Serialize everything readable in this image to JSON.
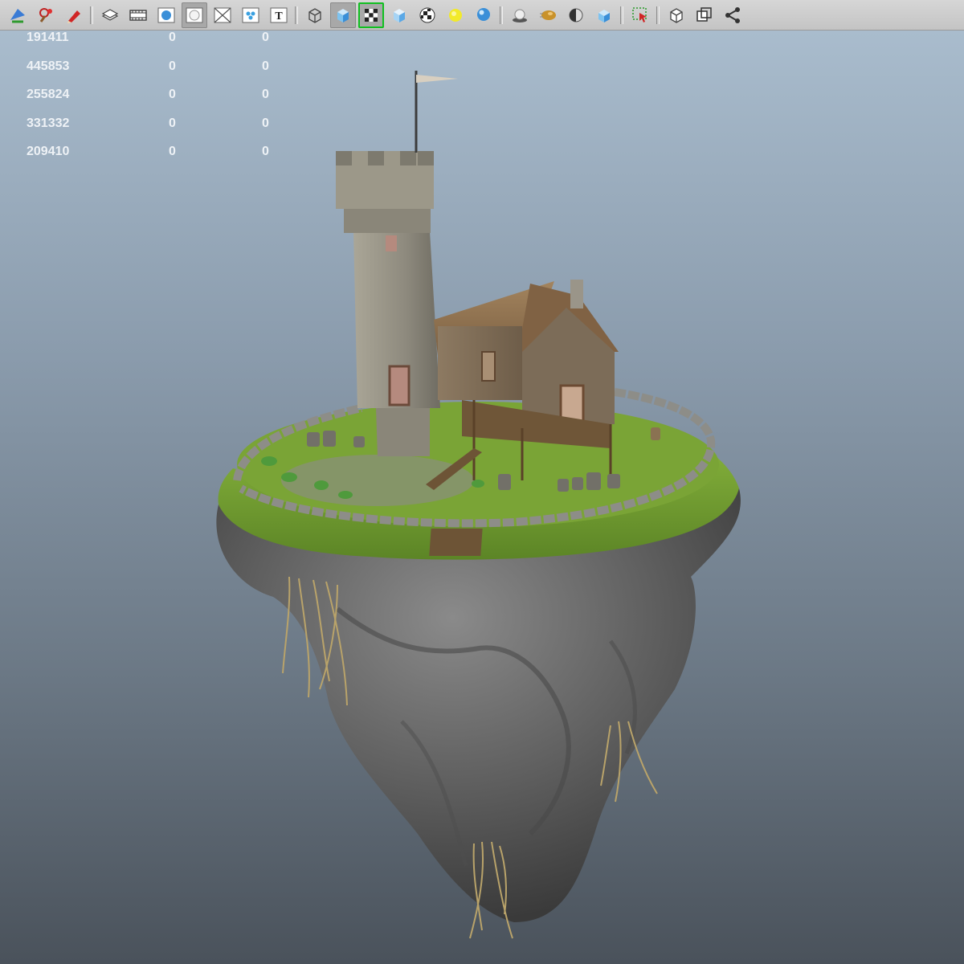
{
  "toolbar": {
    "buttons": [
      {
        "icon": "camera-select-icon"
      },
      {
        "icon": "camera-attributes-icon"
      },
      {
        "icon": "bookmark-pencil-icon"
      },
      {
        "sep": true
      },
      {
        "icon": "image-plane-icon"
      },
      {
        "icon": "film-gate-icon"
      },
      {
        "icon": "sphere-resolution-icon"
      },
      {
        "icon": "safe-action-icon",
        "active": true
      },
      {
        "icon": "grid-cross-icon"
      },
      {
        "icon": "field-chart-icon"
      },
      {
        "icon": "text-T-icon"
      },
      {
        "sep": true
      },
      {
        "icon": "wireframe-cube-icon"
      },
      {
        "icon": "smooth-shade-cube-icon",
        "active": true
      },
      {
        "icon": "wireframe-on-shaded-icon",
        "active": true,
        "highlighted": true
      },
      {
        "icon": "default-material-cube-icon"
      },
      {
        "icon": "textured-checker-icon"
      },
      {
        "icon": "lighting-sun-icon"
      },
      {
        "icon": "shadows-sphere-icon"
      },
      {
        "sep": true
      },
      {
        "icon": "screen-space-ao-icon"
      },
      {
        "icon": "motion-blur-icon"
      },
      {
        "icon": "anti-alias-icon"
      },
      {
        "icon": "depth-of-field-icon"
      },
      {
        "sep": true
      },
      {
        "icon": "isolate-select-icon"
      },
      {
        "sep": true
      },
      {
        "icon": "xray-cube-icon"
      },
      {
        "icon": "xray-joints-icon"
      },
      {
        "icon": "xray-components-icon"
      }
    ]
  },
  "hud": {
    "rows": [
      [
        "191411",
        "0",
        "0"
      ],
      [
        "445853",
        "0",
        "0"
      ],
      [
        "255824",
        "0",
        "0"
      ],
      [
        "331332",
        "0",
        "0"
      ],
      [
        "209410",
        "0",
        "0"
      ]
    ]
  },
  "colors": {
    "sky_top": "#a9bccd",
    "sky_bottom": "#4a525b",
    "grass": "#6f9a2e",
    "rock": "#6b6b6b",
    "stone_tower": "#9a968a",
    "wood": "#7a6650",
    "roof": "#8e6f4c",
    "roots": "#b9a36a"
  },
  "scene": {
    "description_icon": "floating-island-castle-icon"
  }
}
